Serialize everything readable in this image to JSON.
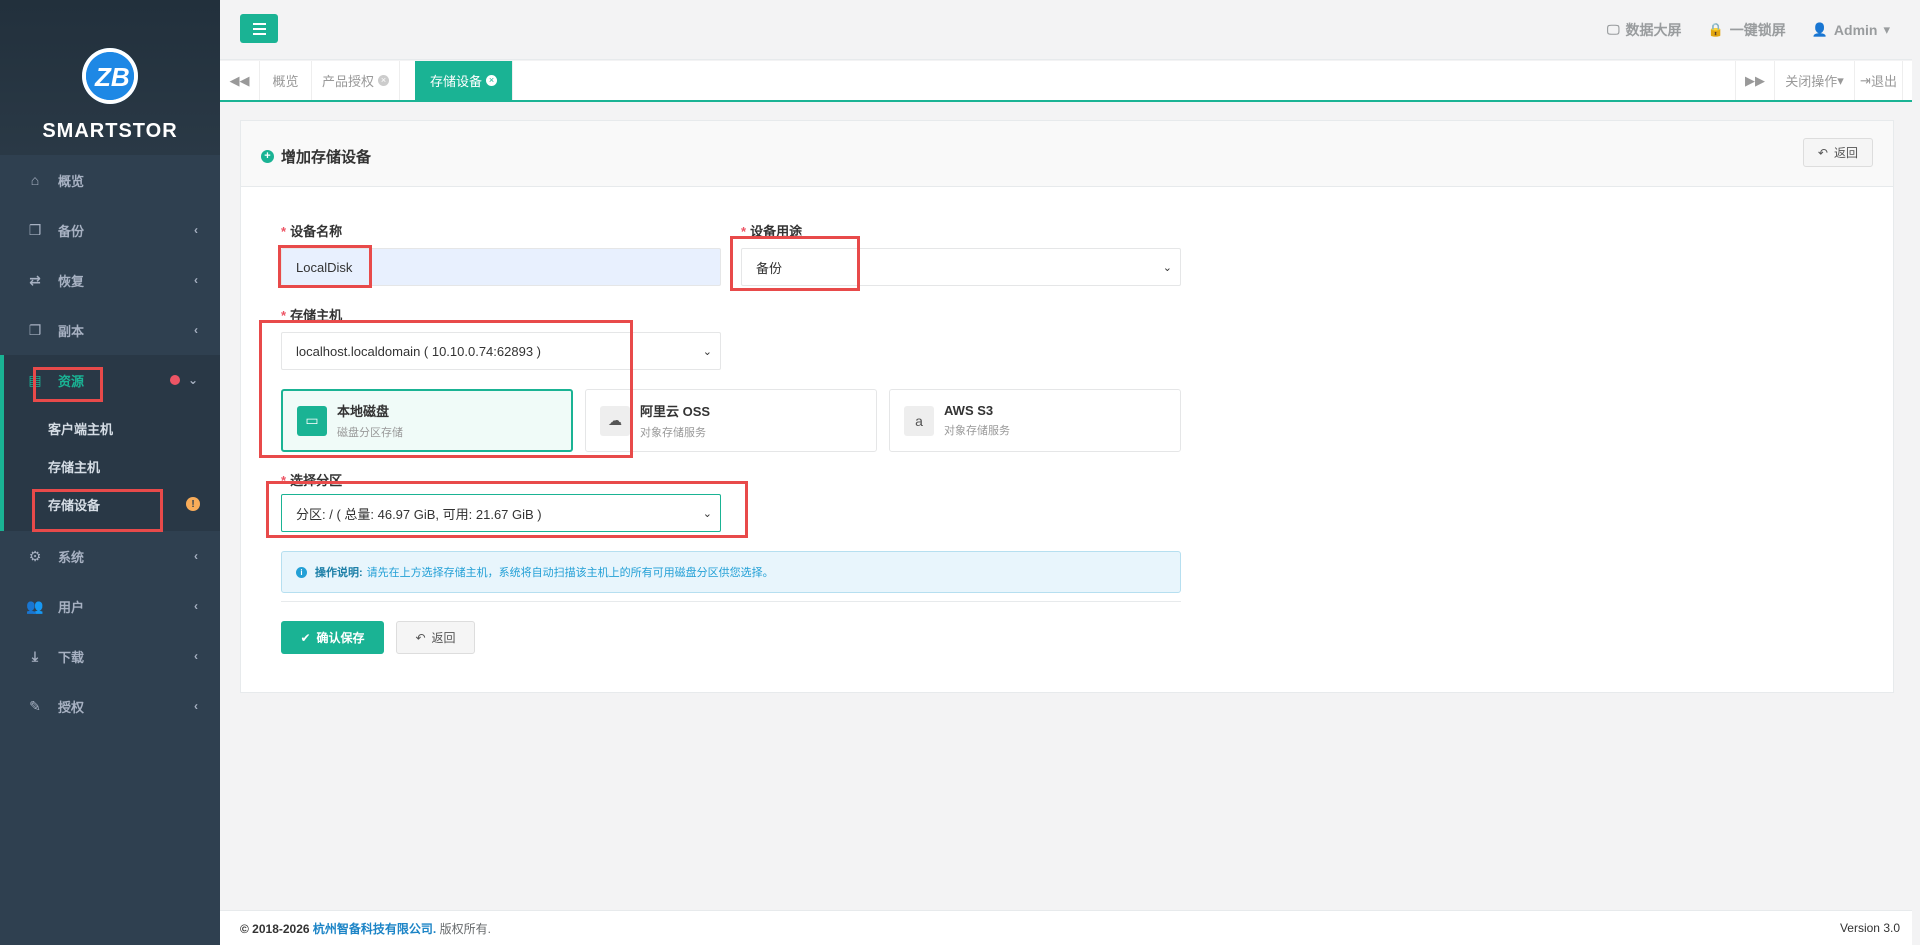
{
  "brand": {
    "name": "SMARTSTOR"
  },
  "colors": {
    "accent": "#1ab394",
    "sidebar": "#2f4050",
    "highlight": "#e84a4a"
  },
  "sidebar": {
    "items": [
      {
        "label": "概览",
        "icon": "home-icon"
      },
      {
        "label": "备份",
        "icon": "cube-icon"
      },
      {
        "label": "恢复",
        "icon": "retweet-icon"
      },
      {
        "label": "副本",
        "icon": "copy-icon"
      },
      {
        "label": "资源",
        "icon": "server-icon"
      },
      {
        "label": "系统",
        "icon": "cogs-icon"
      },
      {
        "label": "用户",
        "icon": "users-icon"
      },
      {
        "label": "下载",
        "icon": "download-icon"
      },
      {
        "label": "授权",
        "icon": "edit-icon"
      }
    ],
    "sub_items": [
      {
        "label": "客户端主机"
      },
      {
        "label": "存储主机"
      },
      {
        "label": "存储设备"
      }
    ]
  },
  "topbar": {
    "dashboard": "数据大屏",
    "lock": "一键锁屏",
    "user": "Admin"
  },
  "tabs": {
    "items": [
      {
        "label": "概览"
      },
      {
        "label": "产品授权"
      },
      {
        "label": "存储设备"
      }
    ],
    "close_ops": "关闭操作",
    "logout": "退出"
  },
  "panel": {
    "title": "增加存储设备",
    "back": "返回"
  },
  "form": {
    "device_name_label": "设备名称",
    "device_name_value": "LocalDisk",
    "usage_label": "设备用途",
    "usage_value": "备份",
    "host_label": "存储主机",
    "host_value": "localhost.localdomain ( 10.10.0.74:62893 )",
    "partition_label": "选择分区",
    "partition_value": "分区: / ( 总量: 46.97 GiB, 可用: 21.67 GiB )",
    "storage_types": [
      {
        "title": "本地磁盘",
        "subtitle": "磁盘分区存储",
        "icon": "hdd-icon"
      },
      {
        "title": "阿里云 OSS",
        "subtitle": "对象存储服务",
        "icon": "cloud-icon"
      },
      {
        "title": "AWS S3",
        "subtitle": "对象存储服务",
        "icon": "amazon-icon"
      }
    ],
    "note_title": "操作说明:",
    "note_text": "请先在上方选择存储主机，系统将自动扫描该主机上的所有可用磁盘分区供您选择。",
    "save": "确认保存",
    "back": "返回"
  },
  "footer": {
    "copyright": "© 2018-2026",
    "org": "杭州智备科技有限公司.",
    "rights": "版权所有.",
    "version": "Version 3.0"
  }
}
